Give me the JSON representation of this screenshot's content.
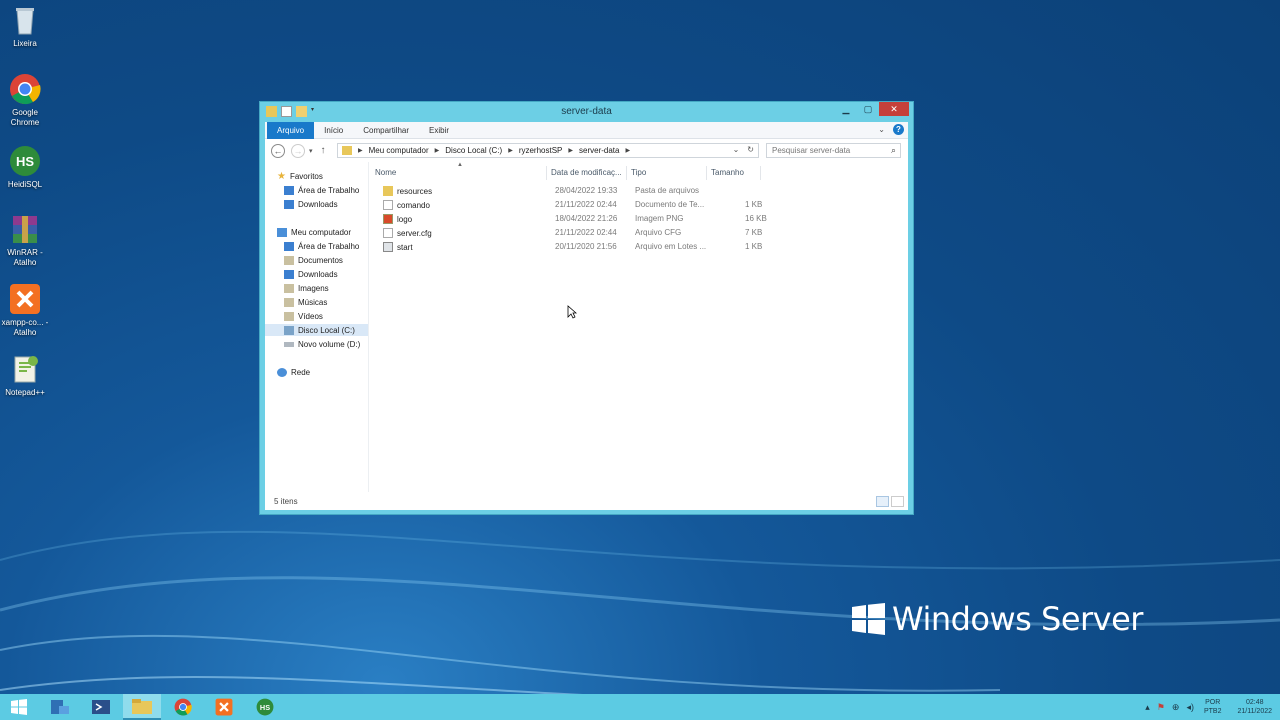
{
  "desktop": {
    "icons": [
      {
        "label": "Lixeira"
      },
      {
        "label": "Google Chrome"
      },
      {
        "label": "HeidiSQL"
      },
      {
        "label": "WinRAR - Atalho"
      },
      {
        "label": "xampp-co... - Atalho"
      },
      {
        "label": "Notepad++"
      }
    ],
    "brand": "Windows Server"
  },
  "window": {
    "title": "server-data",
    "ribbon_tabs": [
      "Arquivo",
      "Início",
      "Compartilhar",
      "Exibir"
    ],
    "breadcrumb": [
      "Meu computador",
      "Disco Local (C:)",
      "ryzerhostSP",
      "server-data"
    ],
    "search_placeholder": "Pesquisar server-data",
    "nav": {
      "favorites_label": "Favoritos",
      "favorites": [
        "Área de Trabalho",
        "Downloads"
      ],
      "computer_label": "Meu computador",
      "computer": [
        "Área de Trabalho",
        "Documentos",
        "Downloads",
        "Imagens",
        "Músicas",
        "Vídeos",
        "Disco Local (C:)",
        "Novo volume (D:)"
      ],
      "network_label": "Rede"
    },
    "columns": [
      "Nome",
      "Data de modificaç...",
      "Tipo",
      "Tamanho"
    ],
    "files": [
      {
        "name": "resources",
        "date": "28/04/2022 19:33",
        "type": "Pasta de arquivos",
        "size": "",
        "icon": "folder-icon"
      },
      {
        "name": "comando",
        "date": "21/11/2022 02:44",
        "type": "Documento de Te...",
        "size": "1 KB",
        "icon": "text-file-icon"
      },
      {
        "name": "logo",
        "date": "18/04/2022 21:26",
        "type": "Imagem PNG",
        "size": "16 KB",
        "icon": "image-file-icon"
      },
      {
        "name": "server.cfg",
        "date": "21/11/2022 02:44",
        "type": "Arquivo CFG",
        "size": "7 KB",
        "icon": "cfg-file-icon"
      },
      {
        "name": "start",
        "date": "20/11/2020 21:56",
        "type": "Arquivo em Lotes ...",
        "size": "1 KB",
        "icon": "batch-file-icon"
      }
    ],
    "status": "5 itens"
  },
  "taskbar": {
    "lang": [
      "POR",
      "PTB2"
    ],
    "time": "02:48",
    "date": "21/11/2022"
  },
  "colors": {
    "accent": "#1979ca",
    "window_frame": "#6ccfe5",
    "close": "#c5403a",
    "taskbar": "#5ccbe3"
  }
}
